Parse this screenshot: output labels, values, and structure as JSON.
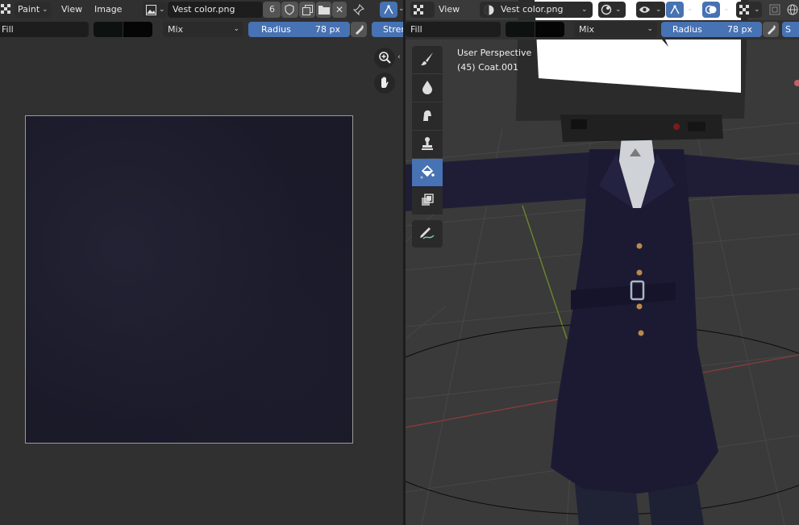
{
  "left_editor": {
    "header": {
      "mode_label": "Paint",
      "menu_view": "View",
      "menu_image": "Image",
      "image_name": "Vest color.png",
      "user_count": "6"
    },
    "tool_settings": {
      "fill_mode": "Fill",
      "blend_mode": "Mix",
      "radius_label": "Radius",
      "radius_value": "78 px",
      "strength_label": "Stren"
    }
  },
  "right_editor": {
    "header": {
      "menu_view": "View",
      "image_name": "Vest color.png"
    },
    "tool_settings": {
      "fill_mode": "Fill",
      "blend_mode": "Mix",
      "radius_label": "Radius",
      "radius_value": "78 px",
      "strength_label": "S"
    },
    "viewport_info": {
      "perspective": "User Perspective",
      "object": "(45) Coat.001"
    },
    "toolbar": [
      {
        "name": "draw",
        "icon": "brush-icon",
        "active": false
      },
      {
        "name": "soften",
        "icon": "drop-icon",
        "active": false
      },
      {
        "name": "smear",
        "icon": "smear-icon",
        "active": false
      },
      {
        "name": "clone",
        "icon": "stamp-icon",
        "active": false
      },
      {
        "name": "fill",
        "icon": "bucket-icon",
        "active": true
      },
      {
        "name": "mask",
        "icon": "mask-icon",
        "active": false
      },
      {
        "name": "annotate",
        "icon": "pencil-icon",
        "active": false
      }
    ]
  },
  "colors": {
    "accent": "#4772b3",
    "header_bg": "#303030",
    "field_bg": "#1d1d1d",
    "texture": "#1b1a29",
    "coat": "#1e1c34"
  }
}
